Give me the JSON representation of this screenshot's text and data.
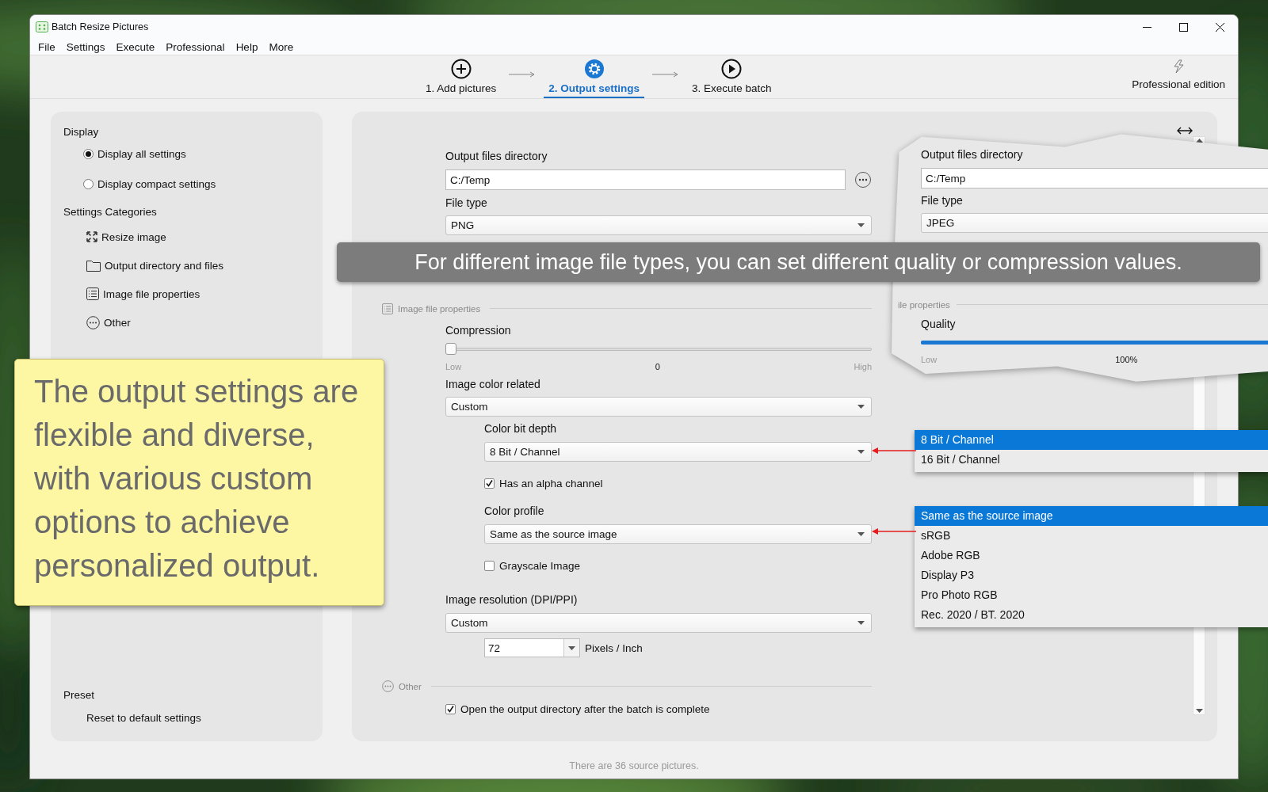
{
  "window": {
    "title": "Batch Resize Pictures"
  },
  "menu": [
    "File",
    "Settings",
    "Execute",
    "Professional",
    "Help",
    "More"
  ],
  "steps": [
    {
      "label": "1. Add pictures",
      "kind": "add",
      "selected": false
    },
    {
      "label": "2. Output settings",
      "kind": "settings",
      "selected": true
    },
    {
      "label": "3. Execute batch",
      "kind": "execute",
      "selected": false
    }
  ],
  "edition": {
    "label": "Professional edition"
  },
  "sidebar": {
    "display": {
      "title": "Display",
      "options": [
        {
          "label": "Display all settings",
          "selected": true
        },
        {
          "label": "Display compact settings",
          "selected": false
        }
      ]
    },
    "categories": {
      "title": "Settings Categories",
      "items": [
        {
          "label": "Resize image",
          "kind": "resize"
        },
        {
          "label": "Output directory and files",
          "kind": "folder"
        },
        {
          "label": "Image file properties",
          "kind": "list"
        },
        {
          "label": "Other",
          "kind": "more"
        }
      ]
    },
    "preset": {
      "title": "Preset",
      "items": [
        "Reset to default settings"
      ]
    }
  },
  "form": {
    "output_dir": {
      "label": "Output files directory",
      "value": "C:/Temp"
    },
    "file_type": {
      "label": "File type",
      "value": "PNG"
    },
    "image_section": {
      "label": "Image file properties"
    },
    "compression": {
      "label": "Compression",
      "level": 0,
      "low": "Low",
      "reading": "0",
      "high": "High"
    },
    "color_related": {
      "label": "Image color related",
      "value": "Custom"
    },
    "bit_depth": {
      "label": "Color bit depth",
      "value": "8 Bit / Channel"
    },
    "alpha": {
      "label": "Has an alpha channel",
      "checked": true
    },
    "color_profile": {
      "label": "Color profile",
      "value": "Same as the source image"
    },
    "grayscale": {
      "label": "Grayscale Image",
      "checked": false
    },
    "resolution": {
      "label": "Image resolution (DPI/PPI)",
      "value": "Custom"
    },
    "dpi": {
      "value": "72",
      "unit": "Pixels / Inch"
    },
    "other_section": {
      "label": "Other"
    },
    "open_dir": {
      "label": "Open the output directory after the batch is complete",
      "checked": true
    }
  },
  "status_bar": "There are 36 source pictures.",
  "comparison": {
    "output_dir": {
      "label": "Output files directory",
      "value": "C:/Temp"
    },
    "file_type": {
      "label": "File type",
      "value": "JPEG"
    },
    "section": {
      "label": "ile properties"
    },
    "quality": {
      "label": "Quality",
      "level": 1,
      "low": "Low",
      "reading": "100%"
    }
  },
  "banner": "For different image file types, you can set different quality or compression values.",
  "note": "The output settings are flexible and diverse, with various custom options to achieve personalized output.",
  "dropdowns": [
    {
      "items": [
        {
          "label": "8 Bit / Channel",
          "selected": true
        },
        {
          "label": "16 Bit / Channel",
          "selected": false
        }
      ]
    },
    {
      "items": [
        {
          "label": "Same as the source image",
          "selected": true
        },
        {
          "label": "sRGB",
          "selected": false
        },
        {
          "label": "Adobe RGB",
          "selected": false
        },
        {
          "label": "Display P3",
          "selected": false
        },
        {
          "label": "Pro Photo RGB",
          "selected": false
        },
        {
          "label": "Rec. 2020 / BT. 2020",
          "selected": false
        }
      ]
    }
  ]
}
